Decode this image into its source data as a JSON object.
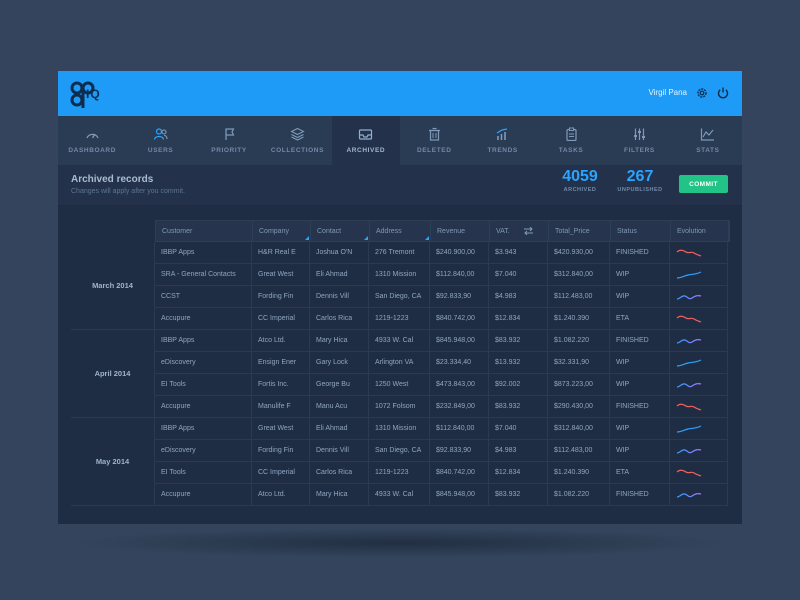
{
  "header": {
    "logo_text": "IQ",
    "user_name": "Virgil Pana",
    "colors": {
      "bar": "#1d9bf6"
    }
  },
  "nav": [
    {
      "label": "DASHBOARD",
      "icon": "gauge-icon"
    },
    {
      "label": "USERS",
      "icon": "users-icon"
    },
    {
      "label": "PRIORITY",
      "icon": "flag-icon"
    },
    {
      "label": "COLLECTIONS",
      "icon": "layers-icon"
    },
    {
      "label": "ARCHIVED",
      "icon": "inbox-icon",
      "active": true
    },
    {
      "label": "DELETED",
      "icon": "trash-icon"
    },
    {
      "label": "TRENDS",
      "icon": "trend-bars-icon"
    },
    {
      "label": "TASKS",
      "icon": "clipboard-icon"
    },
    {
      "label": "FILTERS",
      "icon": "sliders-icon"
    },
    {
      "label": "STATS",
      "icon": "line-chart-icon"
    }
  ],
  "summary": {
    "title": "Archived records",
    "subtitle": "Changes will apply after you commit.",
    "archived_count": "4059",
    "archived_label": "ARCHIVED",
    "unpublished_count": "267",
    "unpublished_label": "UNPUBLISHED",
    "commit_label": "COMMIT"
  },
  "table": {
    "columns": [
      "Customer",
      "Company",
      "Contact",
      "Address",
      "Revenue",
      "VAT.",
      "Total_Price",
      "Status",
      "Evolution"
    ],
    "groups": [
      "March 2014",
      "April 2014",
      "May 2014"
    ],
    "rows": [
      {
        "customer": "IBBP Apps",
        "company": "H&R Real E",
        "contact": "Joshua O'N",
        "address": "276 Tremont",
        "revenue": "$240.900,00",
        "vat": "$3.943",
        "total": "$420.930,00",
        "status": "FINISHED",
        "trend": "down"
      },
      {
        "customer": "SRA - General Contacts",
        "company": "Great West",
        "contact": "Eli Ahmad",
        "address": "1310 Mission",
        "revenue": "$112.840,00",
        "vat": "$7.040",
        "total": "$312.840,00",
        "status": "WIP",
        "trend": "up"
      },
      {
        "customer": "CCST",
        "company": "Fording Fin",
        "contact": "Dennis Vill",
        "address": "San Diego, CA",
        "revenue": "$92.833,90",
        "vat": "$4.983",
        "total": "$112.483,00",
        "status": "WIP",
        "trend": "wave"
      },
      {
        "customer": "Accupure",
        "company": "CC Imperial",
        "contact": "Carlos Rica",
        "address": "1219-1223",
        "revenue": "$840.742,00",
        "vat": "$12.834",
        "total": "$1.240.390",
        "status": "ETA",
        "trend": "down"
      },
      {
        "customer": "IBBP Apps",
        "company": "Atco Ltd.",
        "contact": "Mary Hica",
        "address": "4933 W. Cal",
        "revenue": "$845.948,00",
        "vat": "$83.932",
        "total": "$1.082.220",
        "status": "FINISHED",
        "trend": "wave"
      },
      {
        "customer": "eDiscovery",
        "company": "Ensign Ener",
        "contact": "Gary Lock",
        "address": "Arlington VA",
        "revenue": "$23.334,40",
        "vat": "$13.932",
        "total": "$32.331,90",
        "status": "WIP",
        "trend": "up"
      },
      {
        "customer": "EI Tools",
        "company": "Fortis Inc.",
        "contact": "George Bu",
        "address": "1250 West",
        "revenue": "$473.843,00",
        "vat": "$92.002",
        "total": "$873.223,00",
        "status": "WIP",
        "trend": "wave"
      },
      {
        "customer": "Accupure",
        "company": "Manulife F",
        "contact": "Manu Acu",
        "address": "1072 Folsom",
        "revenue": "$232.849,00",
        "vat": "$83.932",
        "total": "$290.430,00",
        "status": "FINISHED",
        "trend": "down"
      },
      {
        "customer": "IBBP Apps",
        "company": "Great West",
        "contact": "Eli Ahmad",
        "address": "1310 Mission",
        "revenue": "$112.840,00",
        "vat": "$7.040",
        "total": "$312.840,00",
        "status": "WIP",
        "trend": "up"
      },
      {
        "customer": "eDiscovery",
        "company": "Fording Fin",
        "contact": "Dennis Vill",
        "address": "San Diego, CA",
        "revenue": "$92.833,90",
        "vat": "$4.983",
        "total": "$112.483,00",
        "status": "WIP",
        "trend": "wave"
      },
      {
        "customer": "EI Tools",
        "company": "CC Imperial",
        "contact": "Carlos Rica",
        "address": "1219-1223",
        "revenue": "$840.742,00",
        "vat": "$12.834",
        "total": "$1.240.390",
        "status": "ETA",
        "trend": "down"
      },
      {
        "customer": "Accupure",
        "company": "Atco Ltd.",
        "contact": "Mary Hica",
        "address": "4933 W. Cal",
        "revenue": "$845.948,00",
        "vat": "$83.932",
        "total": "$1.082.220",
        "status": "FINISHED",
        "trend": "wave"
      }
    ],
    "trend_colors": {
      "down": "#f0645e",
      "up": "#2ba3ff",
      "wave_start": "#2ba3ff",
      "wave_end": "#a970ff"
    }
  }
}
